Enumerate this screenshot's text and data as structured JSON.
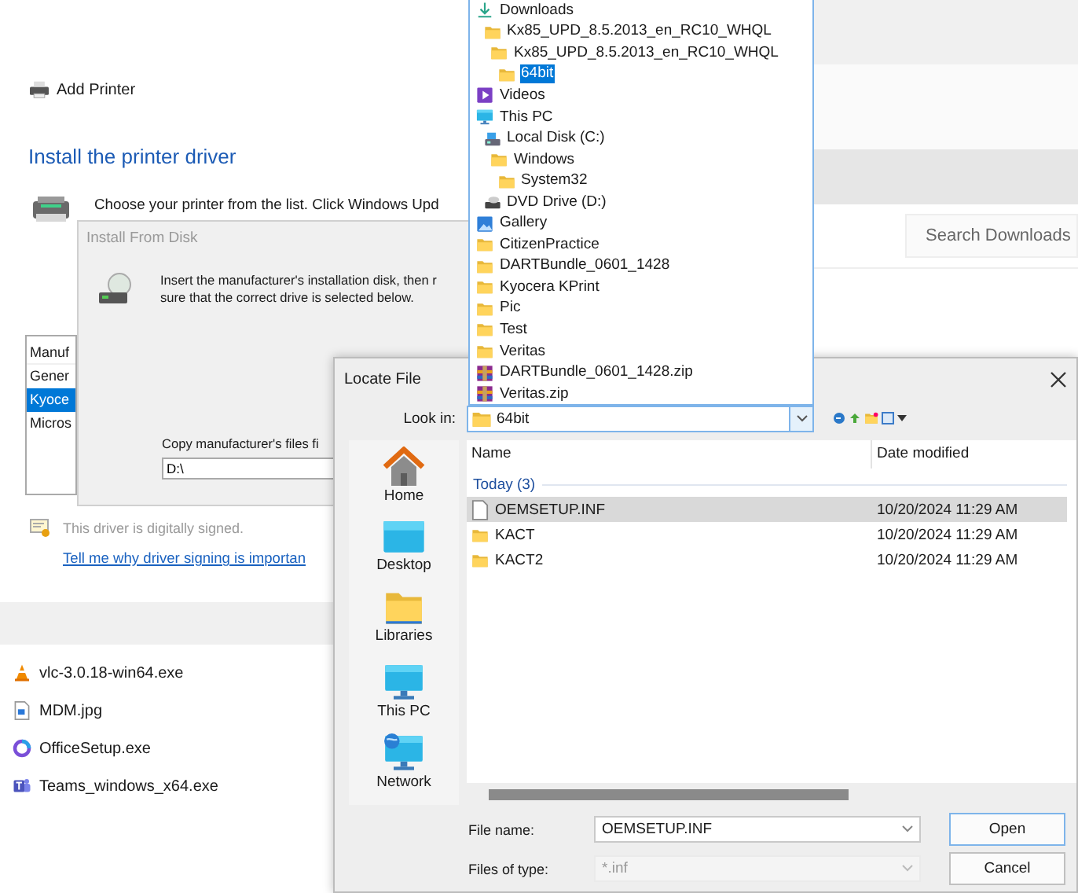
{
  "explorer": {
    "search": {
      "placeholder": "Search Downloads"
    },
    "files": [
      {
        "name": "vlc-3.0.18-win64.exe",
        "kind": "vlc"
      },
      {
        "name": "MDM.jpg",
        "kind": "image"
      },
      {
        "name": "OfficeSetup.exe",
        "kind": "office"
      },
      {
        "name": "Teams_windows_x64.exe",
        "kind": "teams"
      }
    ]
  },
  "wizard": {
    "title": "Add Printer",
    "heading": "Install the printer driver",
    "instruction": "Choose your printer from the list. Click Windows Upd",
    "manufacturers": [
      {
        "label": "Manuf",
        "kind": "header",
        "selected": false
      },
      {
        "label": "Gener",
        "kind": "item",
        "selected": false
      },
      {
        "label": "Kyoce",
        "kind": "item",
        "selected": true
      },
      {
        "label": "Micros",
        "kind": "item",
        "selected": false
      }
    ],
    "signed": "This driver is digitally signed.",
    "link": "Tell me why driver signing is importan"
  },
  "install_from_disk": {
    "title": "Install From Disk",
    "message_lines": [
      "Insert the manufacturer's installation disk, then r",
      "sure that the correct drive is selected below."
    ],
    "copy_label": "Copy manufacturer's files fi",
    "path": "D:\\"
  },
  "locate_file": {
    "title": "Locate File",
    "look_in_label": "Look in:",
    "look_in": "64bit",
    "places": [
      {
        "label": "Home",
        "kind": "home",
        "selected": false
      },
      {
        "label": "Desktop",
        "kind": "desktop",
        "selected": false
      },
      {
        "label": "Libraries",
        "kind": "libraries",
        "selected": false
      },
      {
        "label": "This PC",
        "kind": "pc",
        "selected": false
      },
      {
        "label": "Network",
        "kind": "network",
        "selected": false
      }
    ],
    "columns": [
      "Name",
      "Date modified"
    ],
    "group": "Today (3)",
    "rows": [
      {
        "name": "OEMSETUP.INF",
        "date": "10/20/2024 11:29 AM",
        "kind": "file",
        "selected": true
      },
      {
        "name": "KACT",
        "date": "10/20/2024 11:29 AM",
        "kind": "folder",
        "selected": false
      },
      {
        "name": "KACT2",
        "date": "10/20/2024 11:29 AM",
        "kind": "folder",
        "selected": false
      }
    ],
    "file_name_label": "File name:",
    "file_name": "OEMSETUP.INF",
    "files_of_type_label": "Files of type:",
    "files_of_type": "*.inf",
    "buttons": [
      "Open",
      "Cancel"
    ]
  },
  "look_in_dropdown": {
    "items": [
      {
        "label": "Downloads",
        "kind": "download",
        "selected": false,
        "children": [
          {
            "label": "Kx85_UPD_8.5.2013_en_RC10_WHQL",
            "kind": "folder",
            "selected": false,
            "children": [
              {
                "label": "Kx85_UPD_8.5.2013_en_RC10_WHQL",
                "kind": "folder",
                "selected": false,
                "children": [
                  {
                    "label": "64bit",
                    "kind": "folder",
                    "selected": true
                  }
                ]
              }
            ]
          }
        ]
      },
      {
        "label": "Videos",
        "kind": "videos",
        "selected": false
      },
      {
        "label": "This PC",
        "kind": "pc",
        "selected": false,
        "children": [
          {
            "label": "Local Disk (C:)",
            "kind": "disk",
            "selected": false,
            "children": [
              {
                "label": "Windows",
                "kind": "folder",
                "selected": false,
                "children": [
                  {
                    "label": "System32",
                    "kind": "folder",
                    "selected": false
                  }
                ]
              }
            ]
          },
          {
            "label": "DVD Drive (D:)",
            "kind": "dvd",
            "selected": false
          }
        ]
      },
      {
        "label": "Gallery",
        "kind": "gallery",
        "selected": false
      },
      {
        "label": "CitizenPractice",
        "kind": "folder",
        "selected": false
      },
      {
        "label": "DARTBundle_0601_1428",
        "kind": "folder",
        "selected": false
      },
      {
        "label": "Kyocera KPrint",
        "kind": "folder",
        "selected": false
      },
      {
        "label": "Pic",
        "kind": "folder",
        "selected": false
      },
      {
        "label": "Test",
        "kind": "folder",
        "selected": false
      },
      {
        "label": "Veritas",
        "kind": "folder",
        "selected": false
      },
      {
        "label": "DARTBundle_0601_1428.zip",
        "kind": "zip",
        "selected": false
      },
      {
        "label": "Veritas.zip",
        "kind": "zip",
        "selected": false
      }
    ]
  }
}
